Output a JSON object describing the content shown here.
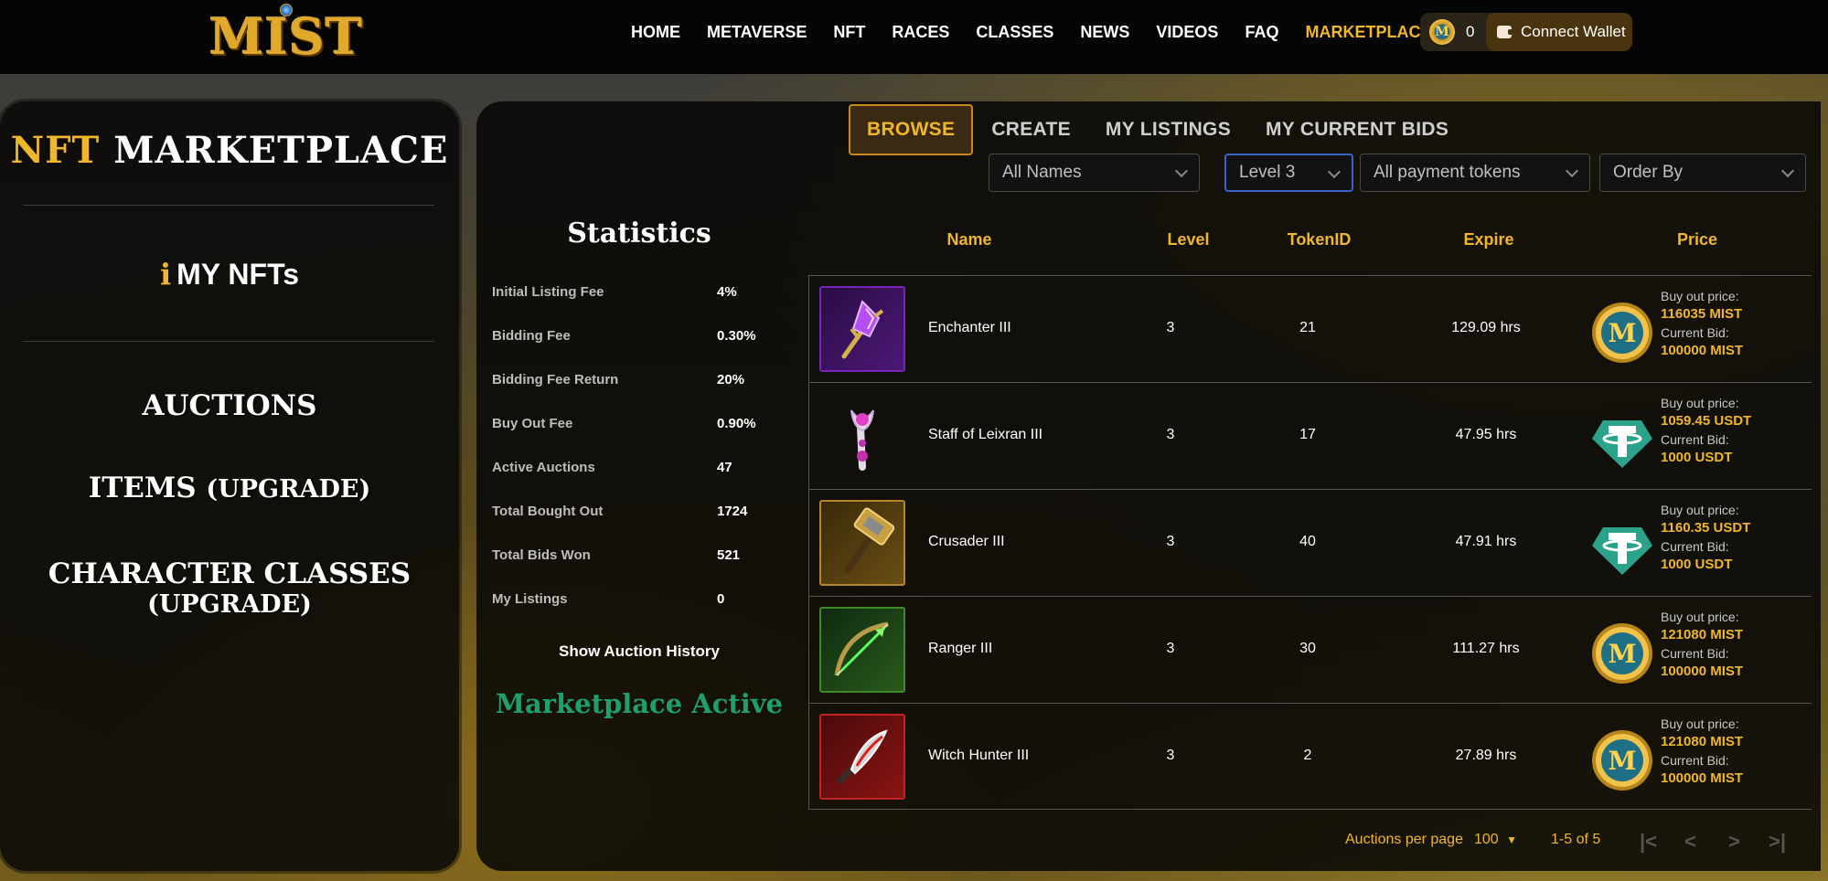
{
  "header": {
    "logo": "MIST",
    "nav": [
      "HOME",
      "METAVERSE",
      "NFT",
      "RACES",
      "CLASSES",
      "NEWS",
      "VIDEOS",
      "FAQ",
      "MARKETPLACE"
    ],
    "active_nav": "MARKETPLACE",
    "wallet_balance": "0",
    "connect_label": "Connect Wallet"
  },
  "sidebar": {
    "title_gold": "NFT",
    "title_white": "MARKETPLACE",
    "my_nfts_icon": "i",
    "my_nfts_label": "MY NFTs",
    "auctions": "AUCTIONS",
    "items": "ITEMS",
    "items_sub": "(UPGRADE)",
    "classes": "CHARACTER CLASSES",
    "classes_sub": "(UPGRADE)"
  },
  "tabs": [
    "BROWSE",
    "CREATE",
    "MY LISTINGS",
    "MY CURRENT BIDS"
  ],
  "filters": {
    "names": "All Names",
    "level": "Level 3",
    "tokens": "All payment tokens",
    "order": "Order By"
  },
  "statistics": {
    "title": "Statistics",
    "rows": [
      {
        "label": "Initial Listing Fee",
        "value": "4%"
      },
      {
        "label": "Bidding Fee",
        "value": "0.30%"
      },
      {
        "label": "Bidding Fee Return",
        "value": "20%"
      },
      {
        "label": "Buy Out Fee",
        "value": "0.90%"
      },
      {
        "label": "Active Auctions",
        "value": "47"
      },
      {
        "label": "Total Bought Out",
        "value": "1724"
      },
      {
        "label": "Total Bids Won",
        "value": "521"
      },
      {
        "label": "My Listings",
        "value": "0"
      }
    ],
    "history_label": "Show Auction History",
    "status": "Marketplace Active"
  },
  "table": {
    "headers": {
      "name": "Name",
      "level": "Level",
      "token": "TokenID",
      "expire": "Expire",
      "price": "Price"
    },
    "buyout_label": "Buy out price:",
    "bid_label": "Current Bid:",
    "rows": [
      {
        "name": "Enchanter III",
        "level": "3",
        "token": "21",
        "expire": "129.09 hrs",
        "currency": "MIST",
        "buyout": "116035 MIST",
        "bid": "100000 MIST",
        "icon": "enchanter-staff-icon",
        "border": "#7a24b8"
      },
      {
        "name": "Staff of Leixran III",
        "level": "3",
        "token": "17",
        "expire": "47.95 hrs",
        "currency": "USDT",
        "buyout": "1059.45 USDT",
        "bid": "1000 USDT",
        "icon": "leixran-staff-icon",
        "border": "transparent"
      },
      {
        "name": "Crusader III",
        "level": "3",
        "token": "40",
        "expire": "47.91 hrs",
        "currency": "USDT",
        "buyout": "1160.35 USDT",
        "bid": "1000 USDT",
        "icon": "crusader-hammer-icon",
        "border": "#b8862a"
      },
      {
        "name": "Ranger III",
        "level": "3",
        "token": "30",
        "expire": "111.27 hrs",
        "currency": "MIST",
        "buyout": "121080 MIST",
        "bid": "100000 MIST",
        "icon": "ranger-bow-icon",
        "border": "#3e8a2a"
      },
      {
        "name": "Witch Hunter III",
        "level": "3",
        "token": "2",
        "expire": "27.89 hrs",
        "currency": "MIST",
        "buyout": "121080 MIST",
        "bid": "100000 MIST",
        "icon": "witch-hunter-blade-icon",
        "border": "#c42222"
      }
    ]
  },
  "pagination": {
    "per_page_label": "Auctions per page",
    "per_page": "100",
    "range": "1-5 of 5"
  },
  "colors": {
    "gold": "#f0b62c",
    "green": "#1fa06a",
    "usdt": "#2aa38a"
  }
}
